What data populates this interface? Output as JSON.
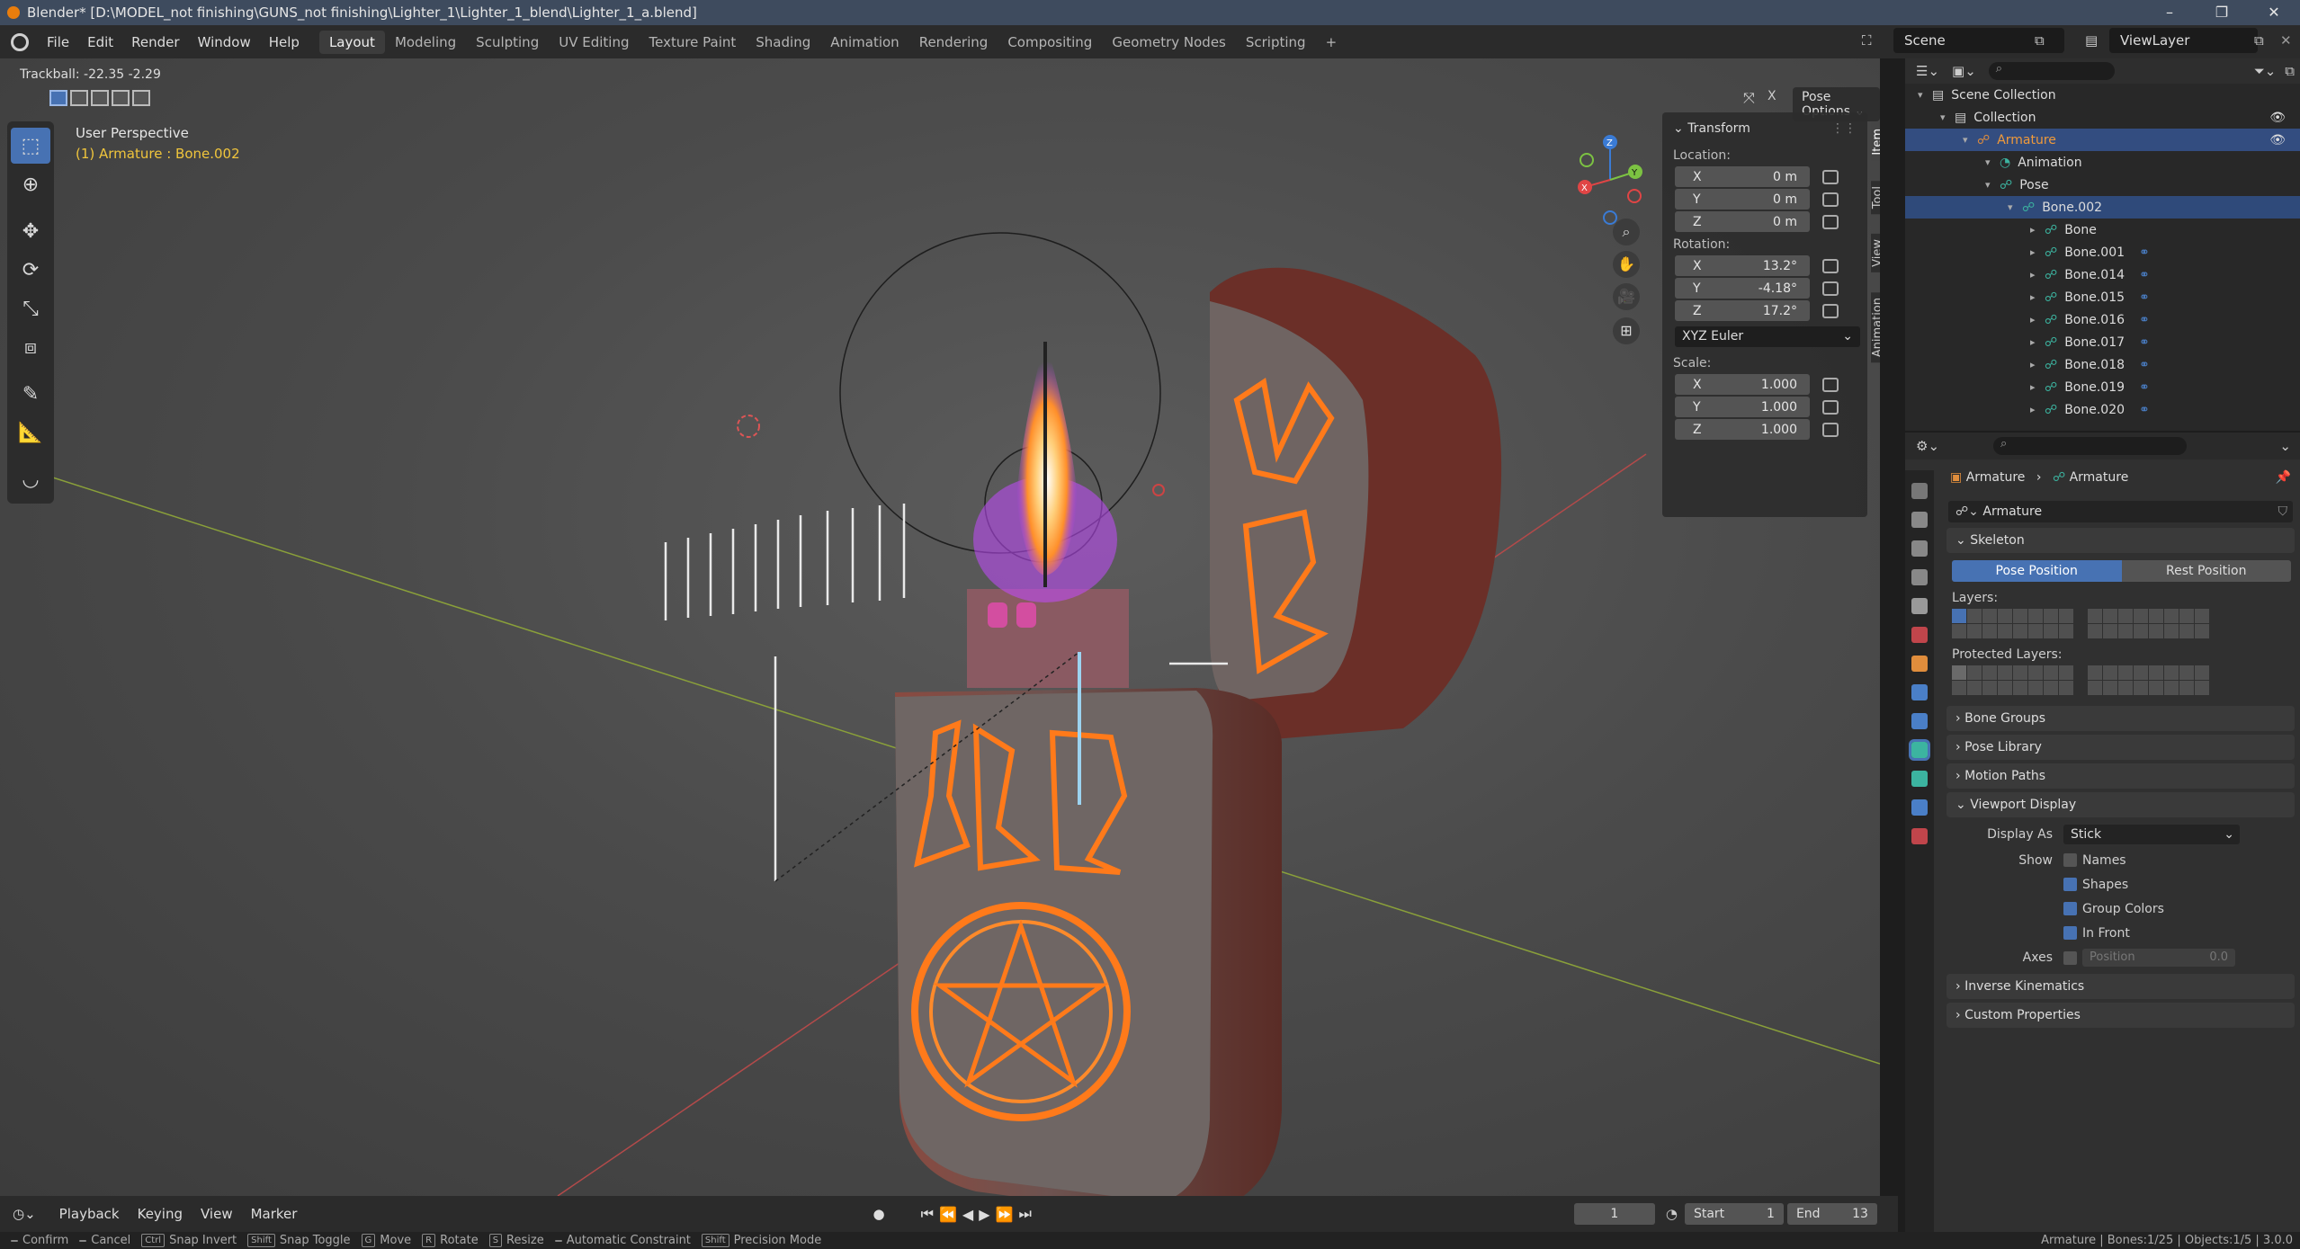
{
  "window": {
    "title": "Blender* [D:\\MODEL_not finishing\\GUNS_not finishing\\Lighter_1\\Lighter_1_blend\\Lighter_1_a.blend]"
  },
  "menu": [
    "File",
    "Edit",
    "Render",
    "Window",
    "Help"
  ],
  "workspaces": [
    "Layout",
    "Modeling",
    "Sculpting",
    "UV Editing",
    "Texture Paint",
    "Shading",
    "Animation",
    "Rendering",
    "Compositing",
    "Geometry Nodes",
    "Scripting",
    "+"
  ],
  "scene": {
    "name": "Scene",
    "view_layer": "ViewLayer"
  },
  "viewport": {
    "status": "Trackball: -22.35 -2.29",
    "perspective": "User Perspective",
    "active": "(1) Armature : Bone.002",
    "pose_options": "Pose Options",
    "sidebar_tabs": [
      "Item",
      "Tool",
      "View",
      "Animation"
    ]
  },
  "transform": {
    "title": "Transform",
    "location_label": "Location:",
    "location": [
      {
        "axis": "X",
        "value": "0 m"
      },
      {
        "axis": "Y",
        "value": "0 m"
      },
      {
        "axis": "Z",
        "value": "0 m"
      }
    ],
    "rotation_label": "Rotation:",
    "rotation": [
      {
        "axis": "X",
        "value": "13.2°"
      },
      {
        "axis": "Y",
        "value": "-4.18°"
      },
      {
        "axis": "Z",
        "value": "17.2°"
      }
    ],
    "rotation_mode": "XYZ Euler",
    "scale_label": "Scale:",
    "scale": [
      {
        "axis": "X",
        "value": "1.000"
      },
      {
        "axis": "Y",
        "value": "1.000"
      },
      {
        "axis": "Z",
        "value": "1.000"
      }
    ]
  },
  "outliner": {
    "rows": [
      {
        "label": "Scene Collection",
        "indent": 0
      },
      {
        "label": "Collection",
        "indent": 1
      },
      {
        "label": "Armature",
        "indent": 2,
        "selected": true
      },
      {
        "label": "Animation",
        "indent": 3
      },
      {
        "label": "Pose",
        "indent": 3
      },
      {
        "label": "Bone.002",
        "indent": 4,
        "highlighted": true
      },
      {
        "label": "Bone",
        "indent": 5
      },
      {
        "label": "Bone.001",
        "indent": 5
      },
      {
        "label": "Bone.014",
        "indent": 5
      },
      {
        "label": "Bone.015",
        "indent": 5
      },
      {
        "label": "Bone.016",
        "indent": 5
      },
      {
        "label": "Bone.017",
        "indent": 5
      },
      {
        "label": "Bone.018",
        "indent": 5
      },
      {
        "label": "Bone.019",
        "indent": 5
      },
      {
        "label": "Bone.020",
        "indent": 5
      }
    ]
  },
  "properties": {
    "breadcrumb": [
      "Armature",
      "Armature"
    ],
    "data_name": "Armature",
    "skeleton": "Skeleton",
    "pose_position": "Pose Position",
    "rest_position": "Rest Position",
    "layers_label": "Layers:",
    "protected_label": "Protected Layers:",
    "bone_groups": "Bone Groups",
    "pose_library": "Pose Library",
    "motion_paths": "Motion Paths",
    "viewport_display": "Viewport Display",
    "display_as_label": "Display As",
    "display_as": "Stick",
    "show_label": "Show",
    "show": [
      {
        "label": "Names",
        "checked": false
      },
      {
        "label": "Shapes",
        "checked": true
      },
      {
        "label": "Group Colors",
        "checked": true
      },
      {
        "label": "In Front",
        "checked": true
      }
    ],
    "axes_label": "Axes",
    "axes_position": "Position",
    "axes_value": "0.0",
    "inverse_kinematics": "Inverse Kinematics",
    "custom_properties": "Custom Properties"
  },
  "timeline": {
    "menus": [
      "Playback",
      "Keying",
      "View",
      "Marker"
    ],
    "current_frame": "1",
    "start_label": "Start",
    "start": "1",
    "end_label": "End",
    "end": "13"
  },
  "statusbar": {
    "items": [
      "Confirm",
      "Cancel",
      "Snap Invert",
      "Snap Toggle",
      "Move",
      "Rotate",
      "Resize",
      "Automatic Constraint",
      "Precision Mode"
    ],
    "keys": [
      "",
      "",
      "Ctrl",
      "Shift",
      "G",
      "R",
      "S",
      "",
      "Shift"
    ],
    "right": "Armature | Bones:1/25 | Objects:1/5 | 3.0.0"
  },
  "colors": {
    "accent": "#4772b3",
    "glow": "#ff7a1a",
    "flame": "#c34bff",
    "lighter": "#7a3a32"
  }
}
